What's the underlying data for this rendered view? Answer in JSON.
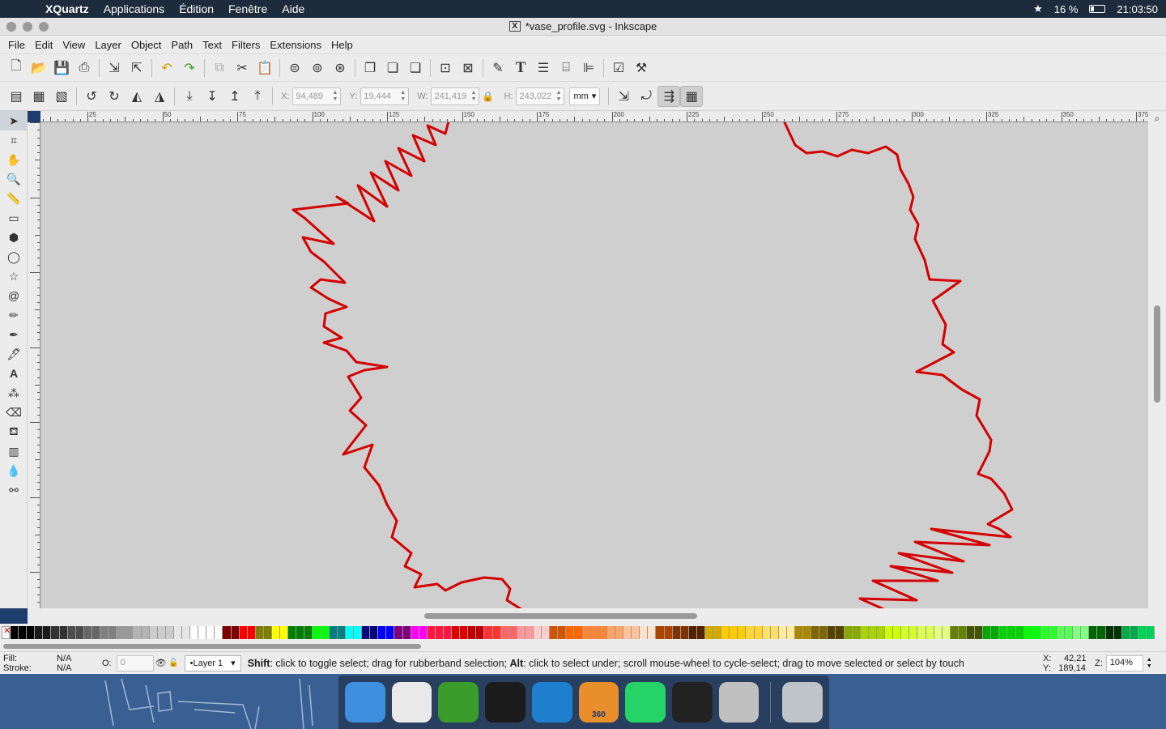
{
  "macos_menubar": {
    "app_name": "XQuartz",
    "items": [
      "Applications",
      "Édition",
      "Fenêtre",
      "Aide"
    ],
    "battery": "16 %",
    "clock": "21:03:50"
  },
  "window": {
    "title": "*vase_profile.svg - Inkscape"
  },
  "menu": [
    "File",
    "Edit",
    "View",
    "Layer",
    "Object",
    "Path",
    "Text",
    "Filters",
    "Extensions",
    "Help"
  ],
  "selector_toolbar": {
    "x_label": "X:",
    "x_value": "94,489",
    "y_label": "Y:",
    "y_value": "19,444",
    "w_label": "W:",
    "w_value": "241,419",
    "h_label": "H:",
    "h_value": "243,022",
    "unit": "mm"
  },
  "ruler": {
    "labels": [
      "25",
      "50",
      "75",
      "100",
      "125",
      "150",
      "175",
      "200",
      "225",
      "250",
      "275",
      "300",
      "325",
      "350",
      "375"
    ]
  },
  "drawing": {
    "stroke_color": "#d40000",
    "canvas_color": "#cfcfcf"
  },
  "palette": [
    "#000000",
    "#1a1a1a",
    "#333333",
    "#4d4d4d",
    "#666666",
    "#808080",
    "#999999",
    "#b3b3b3",
    "#cccccc",
    "#e6e6e6",
    "#ffffff",
    "#ffffff",
    "#800000",
    "#ff0000",
    "#808000",
    "#ffff00",
    "#008000",
    "#00ff00",
    "#008080",
    "#00ffff",
    "#000080",
    "#0000ff",
    "#800080",
    "#ff00ff",
    "#ff1744",
    "#e00000",
    "#c00000",
    "#ff3333",
    "#ff6666",
    "#ff9999",
    "#ffcccc",
    "#d45500",
    "#ff6600",
    "#ff8533",
    "#ffa366",
    "#ffc299",
    "#ffe0cc",
    "#aa4400",
    "#803300",
    "#552200",
    "#d4aa00",
    "#ffcc00",
    "#ffd633",
    "#ffe066",
    "#ffeb99",
    "#aa8800",
    "#806600",
    "#554400",
    "#88aa00",
    "#aad400",
    "#ccff00",
    "#d4ff2a",
    "#ddff55",
    "#e5ff80",
    "#668000",
    "#445500",
    "#00aa00",
    "#00d400",
    "#00ff00",
    "#2aff2a",
    "#55ff55",
    "#80ff80",
    "#006600",
    "#003300",
    "#00aa44",
    "#00d455"
  ],
  "status": {
    "fill_label": "Fill:",
    "fill_value": "N/A",
    "stroke_label": "Stroke:",
    "stroke_value": "N/A",
    "opacity_label": "O:",
    "opacity_value": "0",
    "layer": "•Layer 1",
    "message_shift": "Shift",
    "message_a": ": click to toggle select; drag for rubberband selection; ",
    "message_alt": "Alt",
    "message_b": ": click to select under; scroll mouse-wheel to cycle-select; drag to move selected or select by touch",
    "x_label": "X:",
    "x_value": "42,21",
    "y_label": "Y:",
    "y_value": "189,14",
    "z_label": "Z:",
    "zoom": "104%"
  },
  "dock": {
    "apps": [
      {
        "name": "Finder",
        "color": "#3d8fe0"
      },
      {
        "name": "Chrome",
        "color": "#e9e9e9"
      },
      {
        "name": "Leaf",
        "color": "#3a9c2a"
      },
      {
        "name": "Terminal",
        "color": "#1c1c1c"
      },
      {
        "name": "Q",
        "color": "#1f7fcf"
      },
      {
        "name": "Fusion 360",
        "color": "#e88e2a",
        "badge": "360"
      },
      {
        "name": "WhatsApp",
        "color": "#25d366"
      },
      {
        "name": "Inkscape",
        "color": "#222222"
      },
      {
        "name": "X11",
        "color": "#c0c0c0"
      },
      {
        "name": "Trash",
        "color": "#bfc4c9"
      }
    ]
  }
}
